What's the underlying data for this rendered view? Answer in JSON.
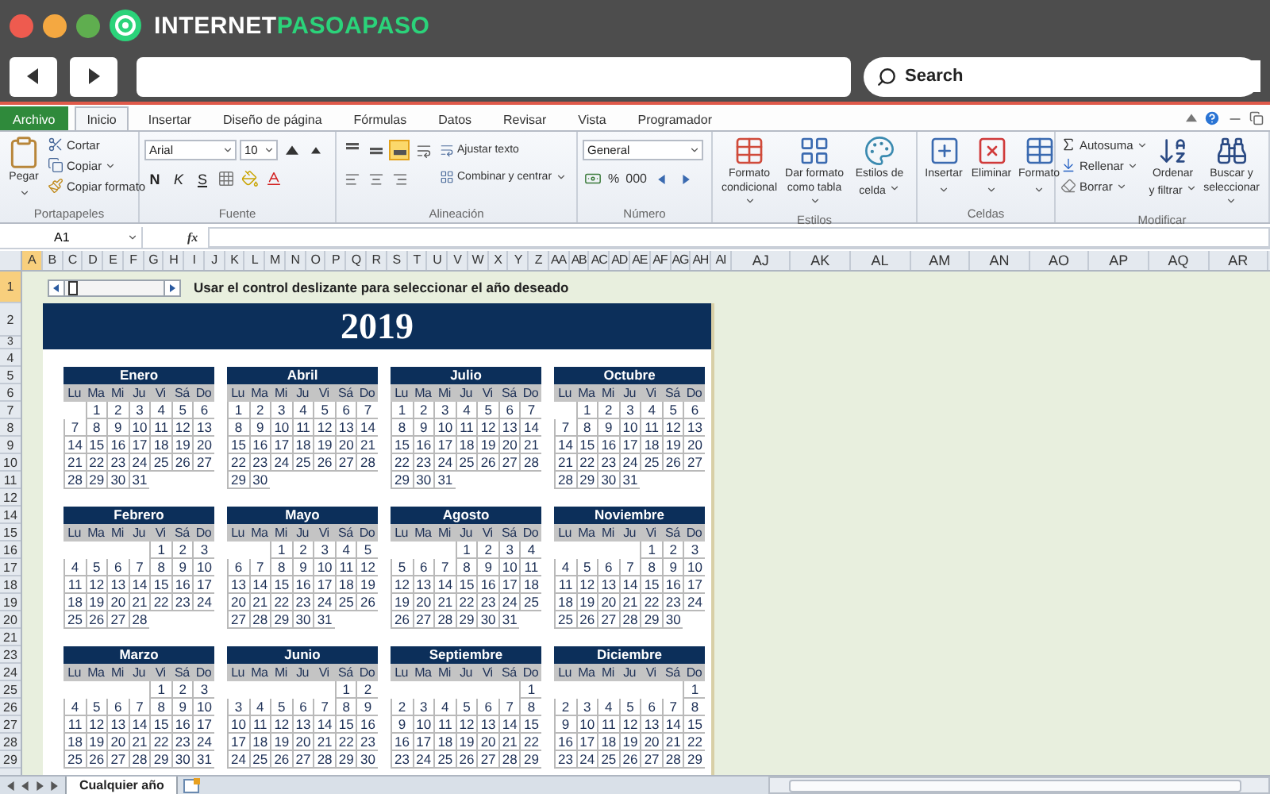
{
  "browser": {
    "logo": [
      "INTERNET",
      "PASOAPASO"
    ],
    "search_placeholder": "Search"
  },
  "ribbon_tabs": [
    {
      "label": "Archivo",
      "kind": "file",
      "selected": false
    },
    {
      "label": "Inicio",
      "kind": "tab",
      "selected": true
    },
    {
      "label": "Insertar",
      "kind": "tab",
      "selected": false
    },
    {
      "label": "Diseño de página",
      "kind": "tab",
      "selected": false
    },
    {
      "label": "Fórmulas",
      "kind": "tab",
      "selected": false
    },
    {
      "label": "Datos",
      "kind": "tab",
      "selected": false
    },
    {
      "label": "Revisar",
      "kind": "tab",
      "selected": false
    },
    {
      "label": "Vista",
      "kind": "tab",
      "selected": false
    },
    {
      "label": "Programador",
      "kind": "tab",
      "selected": false
    }
  ],
  "ribbon": {
    "portapapeles": {
      "label": "Portapapeles",
      "paste": "Pegar",
      "cut": "Cortar",
      "copy": "Copiar",
      "format_painter": "Copiar formato"
    },
    "fuente": {
      "label": "Fuente",
      "font": "Arial",
      "size": "10",
      "bold": "N",
      "italic": "K",
      "underline": "S"
    },
    "alineacion": {
      "label": "Alineación",
      "vertical_align": [
        {
          "selected": false
        },
        {
          "selected": false
        },
        {
          "selected": true
        }
      ],
      "wrap": "Ajustar texto",
      "merge": "Combinar y centrar"
    },
    "numero": {
      "label": "Número",
      "format": "General",
      "percent": "%",
      "thousands": "000"
    },
    "estilos": {
      "label": "Estilos",
      "buttons": [
        "Formato condicional",
        "Dar formato como tabla",
        "Estilos de celda"
      ]
    },
    "celdas": {
      "label": "Celdas",
      "buttons": [
        "Insertar",
        "Eliminar",
        "Formato"
      ]
    },
    "modificar": {
      "label": "Modificar",
      "autosum": "Autosuma",
      "fill": "Rellenar",
      "clear": "Borrar",
      "buttons": [
        "Ordenar y filtrar",
        "Buscar y seleccionar"
      ]
    }
  },
  "formula_bar": {
    "name_box": "A1",
    "fx": "fx"
  },
  "columns": [
    {
      "label": "A",
      "selected": true
    },
    {
      "label": "B",
      "selected": false
    },
    {
      "label": "C",
      "selected": false
    },
    {
      "label": "D",
      "selected": false
    },
    {
      "label": "E",
      "selected": false
    },
    {
      "label": "F",
      "selected": false
    },
    {
      "label": "G",
      "selected": false
    },
    {
      "label": "H",
      "selected": false
    },
    {
      "label": "I",
      "selected": false
    },
    {
      "label": "J",
      "selected": false
    },
    {
      "label": "K",
      "selected": false
    },
    {
      "label": "L",
      "selected": false
    },
    {
      "label": "M",
      "selected": false
    },
    {
      "label": "N",
      "selected": false
    },
    {
      "label": "O",
      "selected": false
    },
    {
      "label": "P",
      "selected": false
    },
    {
      "label": "Q",
      "selected": false
    },
    {
      "label": "R",
      "selected": false
    },
    {
      "label": "S",
      "selected": false
    },
    {
      "label": "T",
      "selected": false
    },
    {
      "label": "U",
      "selected": false
    },
    {
      "label": "V",
      "selected": false
    },
    {
      "label": "W",
      "selected": false
    },
    {
      "label": "X",
      "selected": false
    },
    {
      "label": "Y",
      "selected": false
    },
    {
      "label": "Z",
      "selected": false
    },
    {
      "label": "AA",
      "selected": false
    },
    {
      "label": "AB",
      "selected": false
    },
    {
      "label": "AC",
      "selected": false
    },
    {
      "label": "AD",
      "selected": false
    },
    {
      "label": "AE",
      "selected": false
    },
    {
      "label": "AF",
      "selected": false
    },
    {
      "label": "AG",
      "selected": false
    },
    {
      "label": "AH",
      "selected": false
    },
    {
      "label": "AI",
      "selected": false
    },
    {
      "label": "AJ",
      "selected": false
    },
    {
      "label": "AK",
      "selected": false
    },
    {
      "label": "AL",
      "selected": false
    },
    {
      "label": "AM",
      "selected": false
    },
    {
      "label": "AN",
      "selected": false
    },
    {
      "label": "AO",
      "selected": false
    },
    {
      "label": "AP",
      "selected": false
    },
    {
      "label": "AQ",
      "selected": false
    },
    {
      "label": "AR",
      "selected": false
    }
  ],
  "rows": [
    {
      "label": "1",
      "selected": true
    },
    {
      "label": "2",
      "selected": false
    },
    {
      "label": "3",
      "selected": false
    },
    {
      "label": "4",
      "selected": false
    },
    {
      "label": "5",
      "selected": false
    },
    {
      "label": "6",
      "selected": false
    },
    {
      "label": "7",
      "selected": false
    },
    {
      "label": "8",
      "selected": false
    },
    {
      "label": "9",
      "selected": false
    },
    {
      "label": "10",
      "selected": false
    },
    {
      "label": "11",
      "selected": false
    },
    {
      "label": "12",
      "selected": false
    },
    {
      "label": "14",
      "selected": false
    },
    {
      "label": "15",
      "selected": false
    },
    {
      "label": "16",
      "selected": false
    },
    {
      "label": "17",
      "selected": false
    },
    {
      "label": "18",
      "selected": false
    },
    {
      "label": "19",
      "selected": false
    },
    {
      "label": "20",
      "selected": false
    },
    {
      "label": "21",
      "selected": false
    },
    {
      "label": "23",
      "selected": false
    },
    {
      "label": "24",
      "selected": false
    },
    {
      "label": "25",
      "selected": false
    },
    {
      "label": "26",
      "selected": false
    },
    {
      "label": "27",
      "selected": false
    },
    {
      "label": "28",
      "selected": false
    },
    {
      "label": "29",
      "selected": false
    }
  ],
  "calendar": {
    "slider": {
      "level": 0.03
    },
    "instruction": "Usar el control deslizante para seleccionar el año deseado",
    "year": "2019",
    "months": [
      {
        "name": "Enero",
        "weekdays": [
          "Lu",
          "Ma",
          "Mi",
          "Ju",
          "Vi",
          "Sá",
          "Do"
        ],
        "weeks": [
          [
            "1",
            "2",
            "3",
            "4",
            "5",
            "6"
          ],
          [
            "7",
            "8",
            "9",
            "10",
            "11",
            "12",
            "13"
          ],
          [
            "14",
            "15",
            "16",
            "17",
            "18",
            "19",
            "20"
          ],
          [
            "21",
            "22",
            "23",
            "24",
            "25",
            "26",
            "27"
          ],
          [
            "28",
            "29",
            "30",
            "31"
          ]
        ]
      },
      {
        "name": "Abril",
        "weekdays": [
          "Lu",
          "Ma",
          "Mi",
          "Ju",
          "Vi",
          "Sá",
          "Do"
        ],
        "weeks": [
          [
            "1",
            "2",
            "3",
            "4",
            "5",
            "6",
            "7"
          ],
          [
            "8",
            "9",
            "10",
            "11",
            "12",
            "13",
            "14"
          ],
          [
            "15",
            "16",
            "17",
            "18",
            "19",
            "20",
            "21"
          ],
          [
            "22",
            "23",
            "24",
            "25",
            "26",
            "27",
            "28"
          ],
          [
            "29",
            "30"
          ]
        ]
      },
      {
        "name": "Julio",
        "weekdays": [
          "Lu",
          "Ma",
          "Mi",
          "Ju",
          "Vi",
          "Sá",
          "Do"
        ],
        "weeks": [
          [
            "1",
            "2",
            "3",
            "4",
            "5",
            "6",
            "7"
          ],
          [
            "8",
            "9",
            "10",
            "11",
            "12",
            "13",
            "14"
          ],
          [
            "15",
            "16",
            "17",
            "18",
            "19",
            "20",
            "21"
          ],
          [
            "22",
            "23",
            "24",
            "25",
            "26",
            "27",
            "28"
          ],
          [
            "29",
            "30",
            "31"
          ]
        ]
      },
      {
        "name": "Octubre",
        "weekdays": [
          "Lu",
          "Ma",
          "Mi",
          "Ju",
          "Vi",
          "Sá",
          "Do"
        ],
        "weeks": [
          [
            "1",
            "2",
            "3",
            "4",
            "5",
            "6"
          ],
          [
            "7",
            "8",
            "9",
            "10",
            "11",
            "12",
            "13"
          ],
          [
            "14",
            "15",
            "16",
            "17",
            "18",
            "19",
            "20"
          ],
          [
            "21",
            "22",
            "23",
            "24",
            "25",
            "26",
            "27"
          ],
          [
            "28",
            "29",
            "30",
            "31"
          ]
        ]
      },
      {
        "name": "Febrero",
        "weekdays": [
          "Lu",
          "Ma",
          "Mi",
          "Ju",
          "Vi",
          "Sá",
          "Do"
        ],
        "weeks": [
          [
            "1",
            "2",
            "3"
          ],
          [
            "4",
            "5",
            "6",
            "7",
            "8",
            "9",
            "10"
          ],
          [
            "11",
            "12",
            "13",
            "14",
            "15",
            "16",
            "17"
          ],
          [
            "18",
            "19",
            "20",
            "21",
            "22",
            "23",
            "24"
          ],
          [
            "25",
            "26",
            "27",
            "28"
          ]
        ]
      },
      {
        "name": "Mayo",
        "weekdays": [
          "Lu",
          "Ma",
          "Mi",
          "Ju",
          "Vi",
          "Sá",
          "Do"
        ],
        "weeks": [
          [
            "1",
            "2",
            "3",
            "4",
            "5"
          ],
          [
            "6",
            "7",
            "8",
            "9",
            "10",
            "11",
            "12"
          ],
          [
            "13",
            "14",
            "15",
            "16",
            "17",
            "18",
            "19"
          ],
          [
            "20",
            "21",
            "22",
            "23",
            "24",
            "25",
            "26"
          ],
          [
            "27",
            "28",
            "29",
            "30",
            "31"
          ]
        ]
      },
      {
        "name": "Agosto",
        "weekdays": [
          "Lu",
          "Ma",
          "Mi",
          "Ju",
          "Vi",
          "Sá",
          "Do"
        ],
        "weeks": [
          [
            "1",
            "2",
            "3",
            "4"
          ],
          [
            "5",
            "6",
            "7",
            "8",
            "9",
            "10",
            "11"
          ],
          [
            "12",
            "13",
            "14",
            "15",
            "16",
            "17",
            "18"
          ],
          [
            "19",
            "20",
            "21",
            "22",
            "23",
            "24",
            "25"
          ],
          [
            "26",
            "27",
            "28",
            "29",
            "30",
            "31"
          ]
        ]
      },
      {
        "name": "Noviembre",
        "weekdays": [
          "Lu",
          "Ma",
          "Mi",
          "Ju",
          "Vi",
          "Sá",
          "Do"
        ],
        "weeks": [
          [
            "1",
            "2",
            "3"
          ],
          [
            "4",
            "5",
            "6",
            "7",
            "8",
            "9",
            "10"
          ],
          [
            "11",
            "12",
            "13",
            "14",
            "15",
            "16",
            "17"
          ],
          [
            "18",
            "19",
            "20",
            "21",
            "22",
            "23",
            "24"
          ],
          [
            "25",
            "26",
            "27",
            "28",
            "29",
            "30"
          ]
        ]
      },
      {
        "name": "Marzo",
        "weekdays": [
          "Lu",
          "Ma",
          "Mi",
          "Ju",
          "Vi",
          "Sá",
          "Do"
        ],
        "weeks": [
          [
            "1",
            "2",
            "3"
          ],
          [
            "4",
            "5",
            "6",
            "7",
            "8",
            "9",
            "10"
          ],
          [
            "11",
            "12",
            "13",
            "14",
            "15",
            "16",
            "17"
          ],
          [
            "18",
            "19",
            "20",
            "21",
            "22",
            "23",
            "24"
          ],
          [
            "25",
            "26",
            "27",
            "28",
            "29",
            "30",
            "31"
          ]
        ]
      },
      {
        "name": "Junio",
        "weekdays": [
          "Lu",
          "Ma",
          "Mi",
          "Ju",
          "Vi",
          "Sá",
          "Do"
        ],
        "weeks": [
          [
            "1",
            "2"
          ],
          [
            "3",
            "4",
            "5",
            "6",
            "7",
            "8",
            "9"
          ],
          [
            "10",
            "11",
            "12",
            "13",
            "14",
            "15",
            "16"
          ],
          [
            "17",
            "18",
            "19",
            "20",
            "21",
            "22",
            "23"
          ],
          [
            "24",
            "25",
            "26",
            "27",
            "28",
            "29",
            "30"
          ]
        ]
      },
      {
        "name": "Septiembre",
        "weekdays": [
          "Lu",
          "Ma",
          "Mi",
          "Ju",
          "Vi",
          "Sá",
          "Do"
        ],
        "weeks": [
          [
            "1"
          ],
          [
            "2",
            "3",
            "4",
            "5",
            "6",
            "7",
            "8"
          ],
          [
            "9",
            "10",
            "11",
            "12",
            "13",
            "14",
            "15"
          ],
          [
            "16",
            "17",
            "18",
            "19",
            "20",
            "21",
            "22"
          ],
          [
            "23",
            "24",
            "25",
            "26",
            "27",
            "28",
            "29"
          ]
        ]
      },
      {
        "name": "Diciembre",
        "weekdays": [
          "Lu",
          "Ma",
          "Mi",
          "Ju",
          "Vi",
          "Sá",
          "Do"
        ],
        "weeks": [
          [
            "1"
          ],
          [
            "2",
            "3",
            "4",
            "5",
            "6",
            "7",
            "8"
          ],
          [
            "9",
            "10",
            "11",
            "12",
            "13",
            "14",
            "15"
          ],
          [
            "16",
            "17",
            "18",
            "19",
            "20",
            "21",
            "22"
          ],
          [
            "23",
            "24",
            "25",
            "26",
            "27",
            "28",
            "29"
          ]
        ]
      }
    ]
  },
  "sheet_tabs": [
    {
      "label": "Cualquier año",
      "selected": true
    }
  ]
}
